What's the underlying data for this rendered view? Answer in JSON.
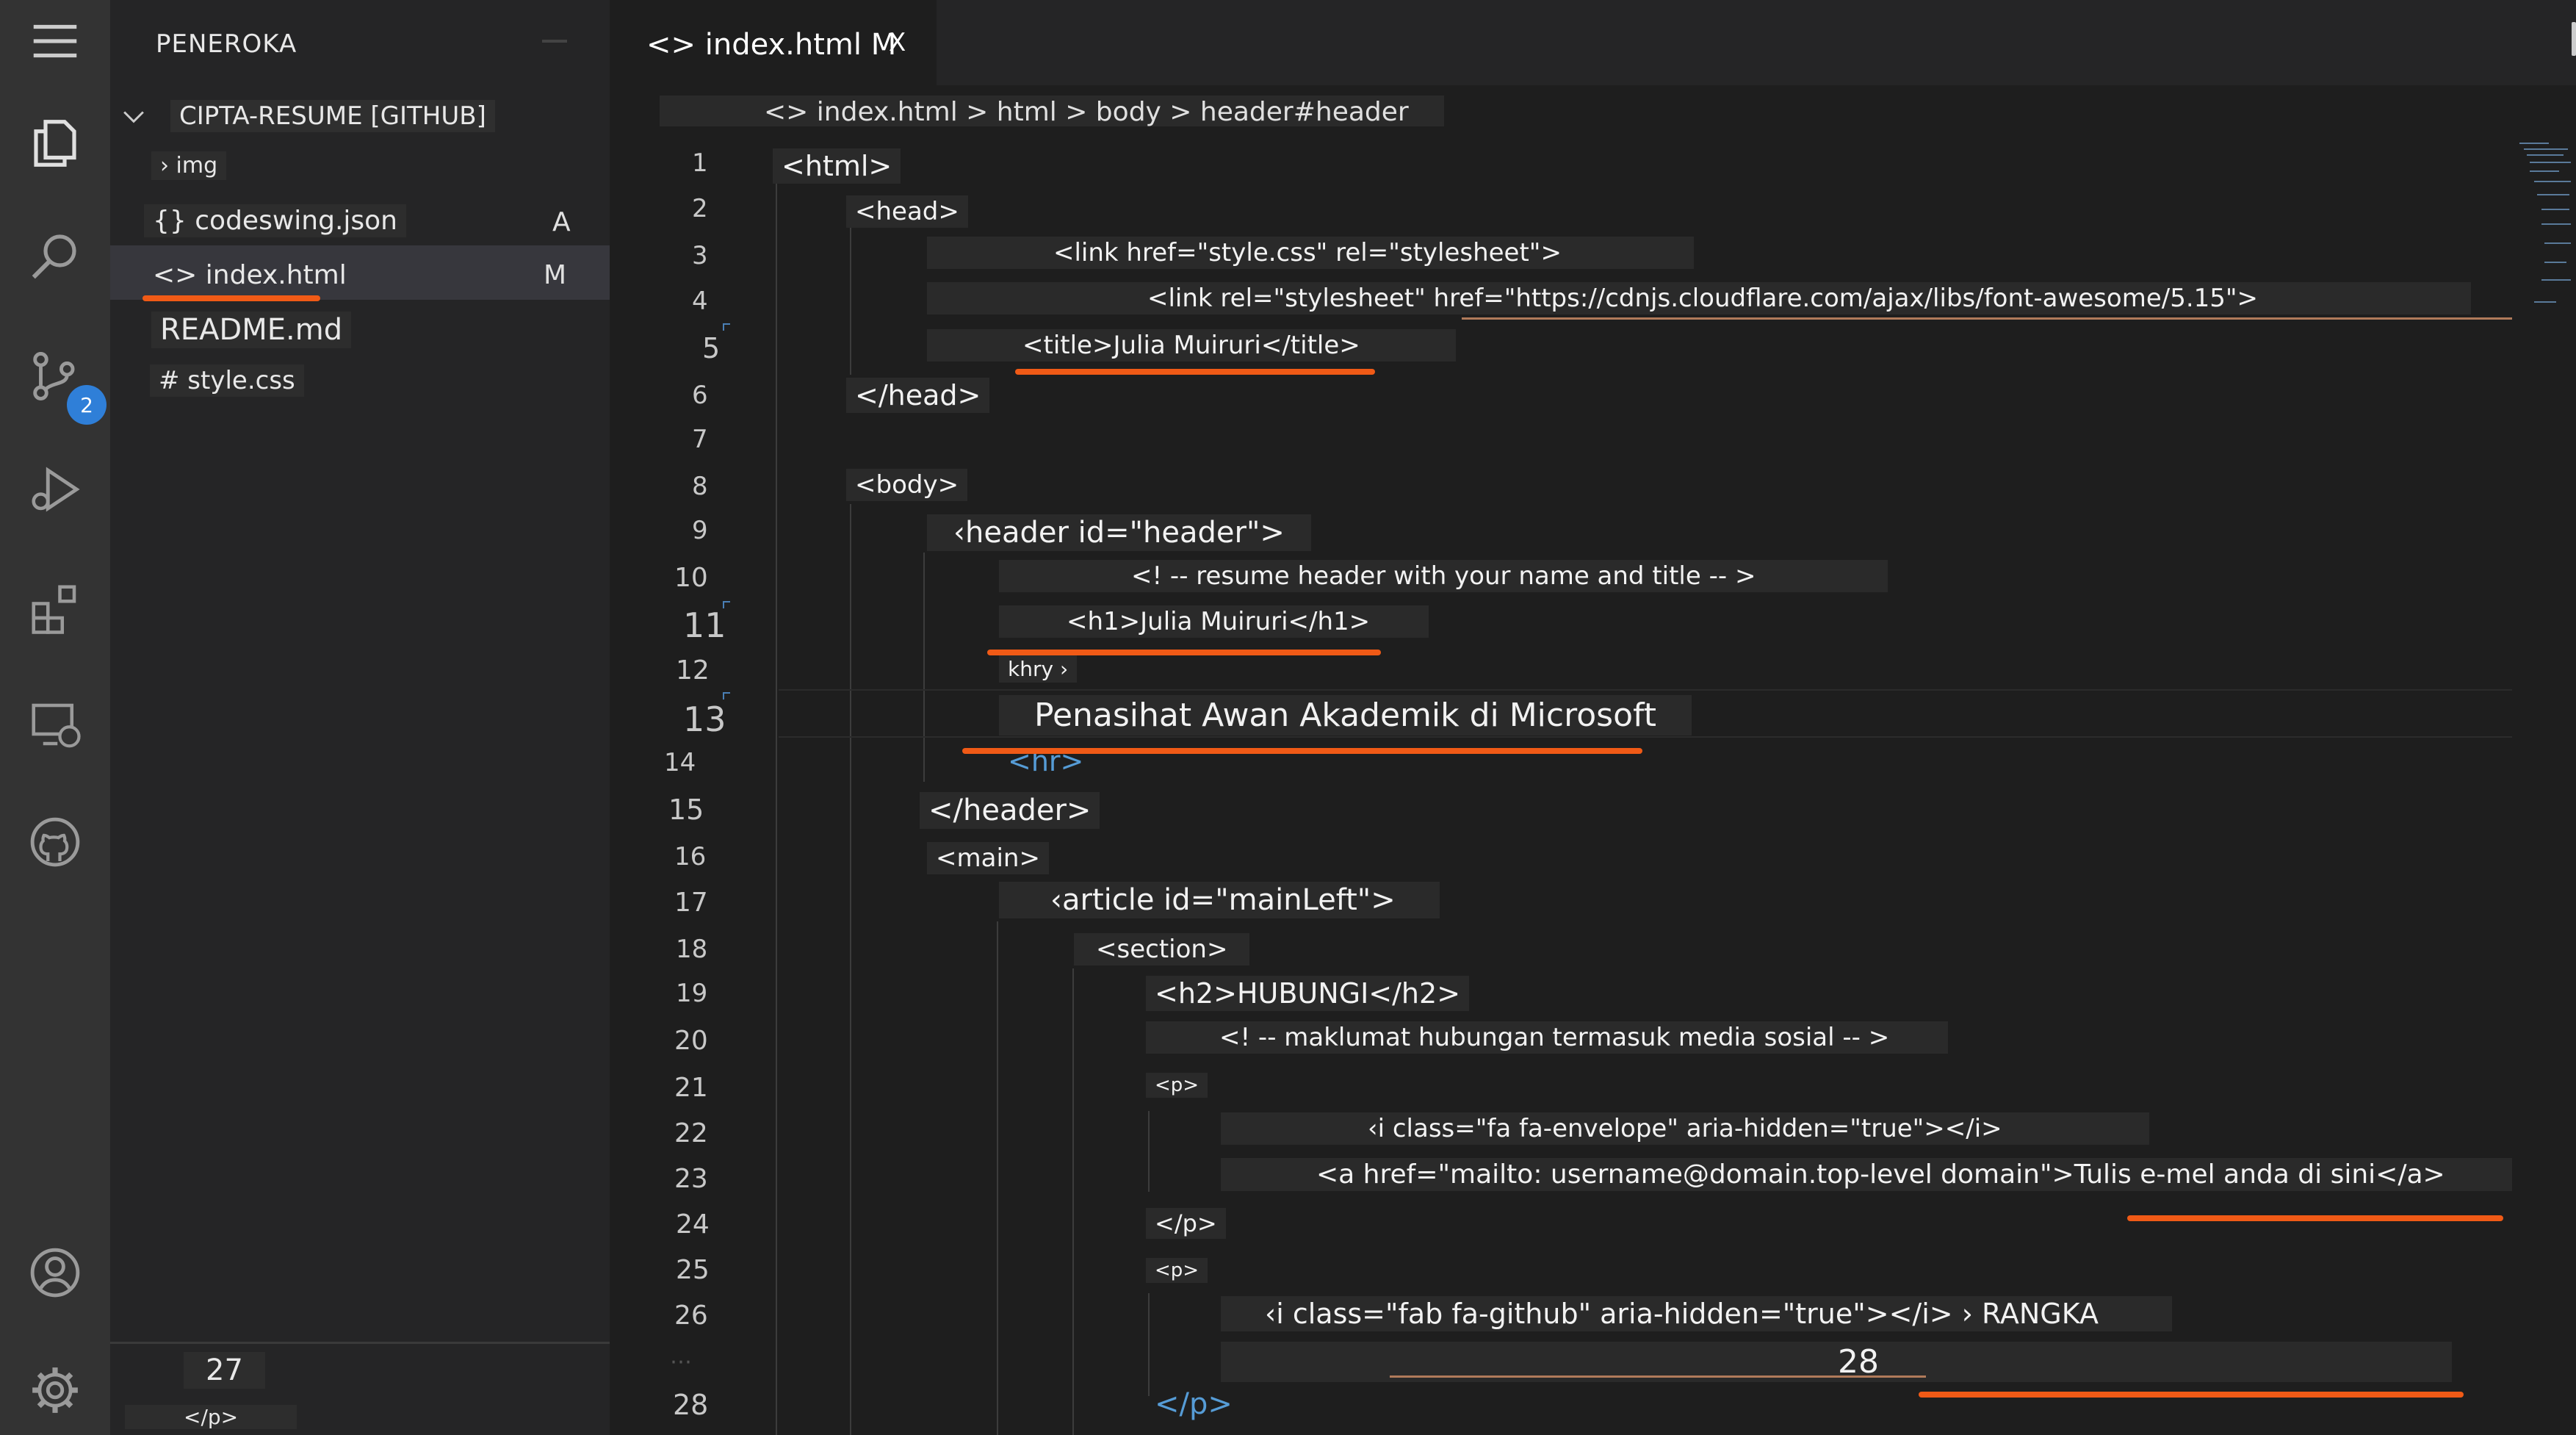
{
  "explorer": {
    "title": "PENEROKA",
    "folder": "CIPTA-RESUME [GITHUB]",
    "items": [
      {
        "label": "› img",
        "status": ""
      },
      {
        "label": "{} codeswing.json",
        "status": "A"
      },
      {
        "label": "<> index.html",
        "status": "M"
      },
      {
        "label": "README.md",
        "status": ""
      },
      {
        "label": "# style.css",
        "status": ""
      }
    ],
    "bottom_number": "27",
    "bottom_code": "</p>"
  },
  "activity": {
    "icons": [
      "menu-icon",
      "files-icon",
      "search-icon",
      "source-control-icon",
      "run-debug-icon",
      "extensions-icon",
      "remote-explorer-icon",
      "github-icon",
      "account-icon",
      "settings-gear-icon"
    ],
    "source_control_badge": "2"
  },
  "tab": {
    "label": "<> index.html M",
    "close": "X"
  },
  "breadcrumb": "<> index.html > html > body > header#header",
  "editor": {
    "lines": [
      {
        "num": "1",
        "code": "<html>"
      },
      {
        "num": "2",
        "code": "<head>"
      },
      {
        "num": "3",
        "code": "<link href=\"style.css\" rel=\"stylesheet\">"
      },
      {
        "num": "4",
        "code": "<link rel=\"stylesheet\" href=\"https://cdnjs.cloudflare.com/ajax/libs/font-awesome/5.15\">"
      },
      {
        "num": "5",
        "code": "<title>Julia Muiruri</title>"
      },
      {
        "num": "6",
        "code": "</head>"
      },
      {
        "num": "7",
        "code": ""
      },
      {
        "num": "8",
        "code": "<body>"
      },
      {
        "num": "9",
        "code": "‹header id=\"header\">"
      },
      {
        "num": "10",
        "code": "<! -- resume header with your name and title -- >"
      },
      {
        "num": "11",
        "code": "<h1>Julia Muiruri</h1>"
      },
      {
        "num": "12",
        "code": "khry ›"
      },
      {
        "num": "13",
        "code": "Penasihat Awan Akademik di Microsoft"
      },
      {
        "num": "14",
        "code": "<hr>"
      },
      {
        "num": "15",
        "code": "</header>"
      },
      {
        "num": "16",
        "code": "<main>"
      },
      {
        "num": "17",
        "code": "‹article id=\"mainLeft\">"
      },
      {
        "num": "18",
        "code": "<section>"
      },
      {
        "num": "19",
        "code": "<h2>HUBUNGI</h2>"
      },
      {
        "num": "20",
        "code": "<! -- maklumat hubungan termasuk media sosial -- >"
      },
      {
        "num": "21",
        "code": "<p>"
      },
      {
        "num": "22",
        "code": "‹i class=\"fa fa-envelope\" aria-hidden=\"true\"></i>"
      },
      {
        "num": "23",
        "code": "<a href=\"mailto: username@domain.top-level domain\">Tulis e-mel anda di sini</a>"
      },
      {
        "num": "24",
        "code": "</p>"
      },
      {
        "num": "25",
        "code": "<p>"
      },
      {
        "num": "26",
        "code": "‹i class=\"fab fa-github\" aria-hidden=\"true\"></i> › RANGKA"
      },
      {
        "num": "",
        "code": "28"
      },
      {
        "num": "28",
        "code": "</p>"
      }
    ]
  },
  "colors": {
    "accent_underline": "#f05a16",
    "badge": "#2f7fd8",
    "tag_blue": "#569cd6"
  }
}
